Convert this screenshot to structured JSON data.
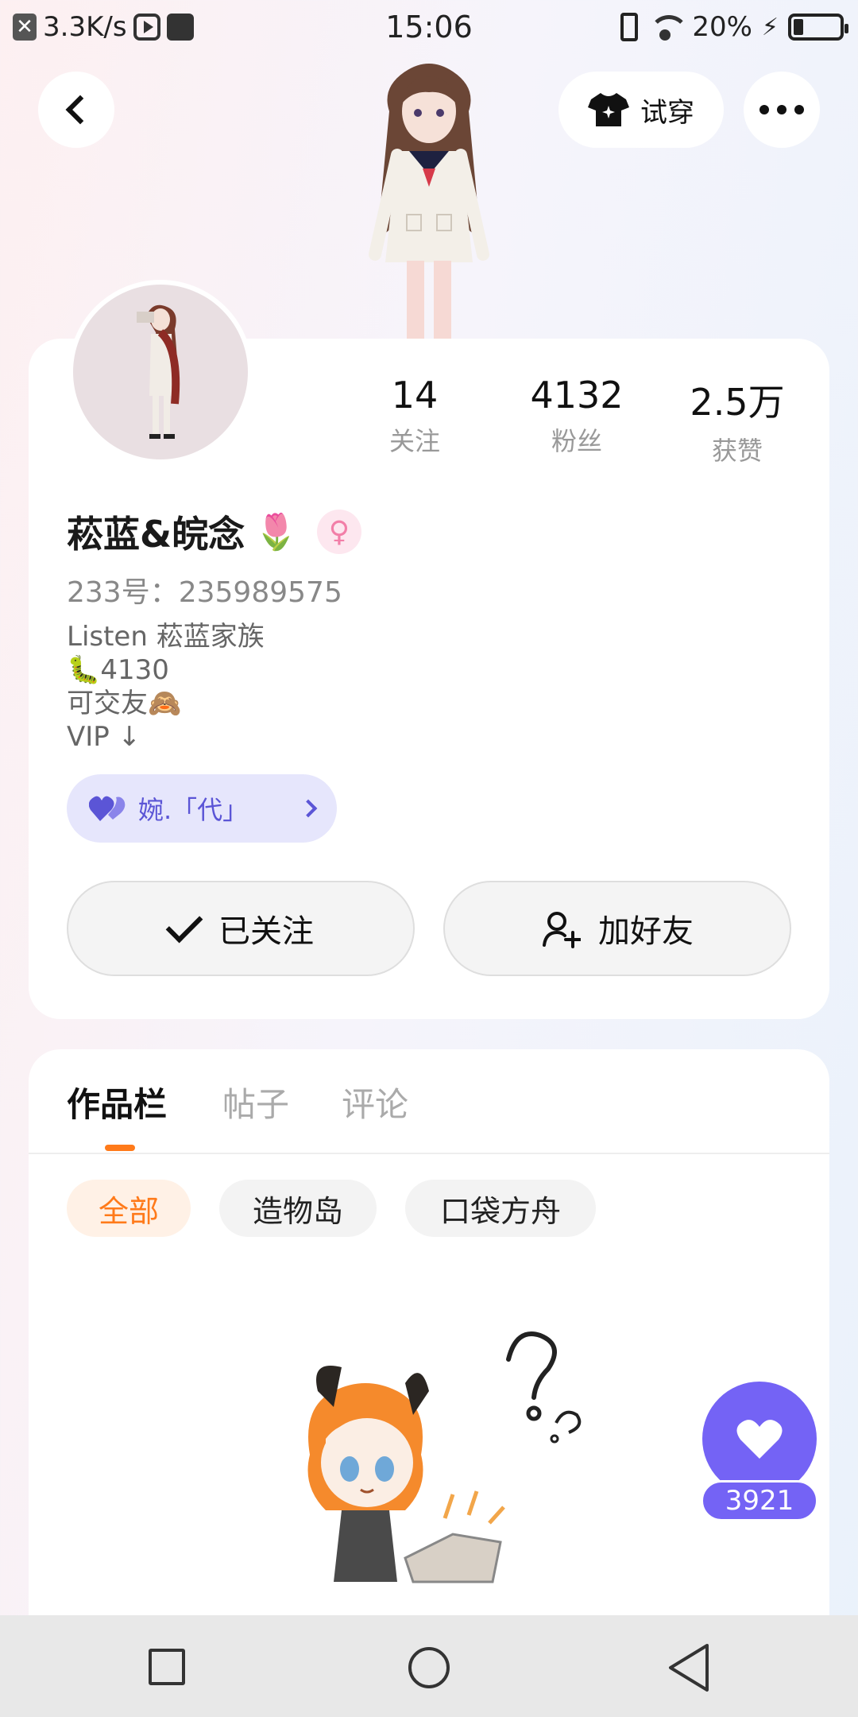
{
  "status_bar": {
    "net_speed": "3.3K/s",
    "time": "15:06",
    "battery": "20%"
  },
  "header": {
    "tryon_label": "试穿"
  },
  "profile": {
    "stats": [
      {
        "value": "14",
        "label": "关注"
      },
      {
        "value": "4132",
        "label": "粉丝"
      },
      {
        "value": "2.5万",
        "label": "获赞"
      }
    ],
    "nickname": "菘蓝&皖念",
    "uid": "233号：235989575",
    "bio_lines": [
      "Listen 菘蓝家族",
      "🐛4130",
      "可交友🙈",
      "VIP ↓"
    ],
    "family_label": "婉.「代」",
    "followed_label": "已关注",
    "add_friend_label": "加好友"
  },
  "works": {
    "tabs": [
      "作品栏",
      "帖子",
      "评论"
    ],
    "active_tab": "作品栏",
    "chips": [
      "全部",
      "造物岛",
      "口袋方舟"
    ],
    "active_chip": "全部",
    "like_count": "3921"
  },
  "colors": {
    "accent_orange": "#ff7a1a",
    "accent_purple": "#7463f5",
    "family_pill_bg": "#e6e6fc"
  }
}
